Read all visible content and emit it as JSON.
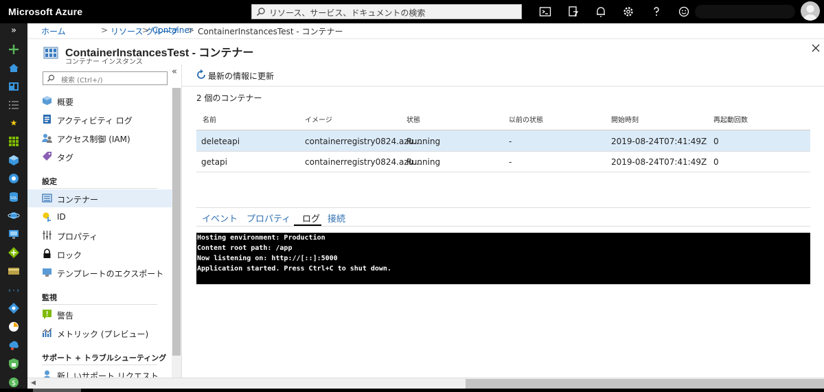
{
  "topbar": {
    "brand": "Microsoft Azure",
    "search_placeholder": "リソース、サービス、ドキュメントの検索",
    "icons": [
      "cloud-shell-icon",
      "directory-filter-icon",
      "notifications-icon",
      "settings-icon",
      "help-icon",
      "feedback-icon"
    ]
  },
  "leftnav": {
    "icons": [
      "expand-icon",
      "create-resource-icon",
      "home-icon",
      "dashboard-icon",
      "all-services-icon",
      "favorites-star-icon",
      "all-resources-icon",
      "resource-groups-icon",
      "app-services-icon",
      "sql-databases-icon",
      "cosmos-db-icon",
      "virtual-machines-icon",
      "load-balancers-icon",
      "storage-accounts-icon",
      "virtual-networks-icon",
      "azure-ad-icon",
      "monitor-icon",
      "advisor-icon",
      "security-center-icon",
      "cost-management-icon"
    ]
  },
  "breadcrumb": {
    "items": [
      "ホーム",
      "リソース グループ",
      "Container",
      "ContainerInstancesTest - コンテナー"
    ],
    "separator": ">"
  },
  "blade": {
    "title": "ContainerInstancesTest - コンテナー",
    "subtitle": "コンテナー インスタンス"
  },
  "menu": {
    "search_placeholder": "検索 (Ctrl+/)",
    "collapse_glyph": "«",
    "items_top": [
      {
        "label": "概要",
        "icon": "overview-icon"
      },
      {
        "label": "アクティビティ ログ",
        "icon": "activity-log-icon"
      },
      {
        "label": "アクセス制御 (IAM)",
        "icon": "access-control-icon"
      },
      {
        "label": "タグ",
        "icon": "tag-icon"
      }
    ],
    "section_settings": "設定",
    "items_settings": [
      {
        "label": "コンテナー",
        "icon": "containers-icon",
        "active": true
      },
      {
        "label": "ID",
        "icon": "identity-icon"
      },
      {
        "label": "プロパティ",
        "icon": "properties-icon"
      },
      {
        "label": "ロック",
        "icon": "lock-icon"
      },
      {
        "label": "テンプレートのエクスポート",
        "icon": "export-template-icon"
      }
    ],
    "section_monitoring": "監視",
    "items_monitoring": [
      {
        "label": "警告",
        "icon": "alerts-icon"
      },
      {
        "label": "メトリック (プレビュー)",
        "icon": "metrics-icon"
      }
    ],
    "section_support": "サポート + トラブルシューティング",
    "items_support": [
      {
        "label": "新しいサポート リクエスト",
        "icon": "support-request-icon"
      }
    ]
  },
  "toolbar": {
    "refresh_label": "最新の情報に更新"
  },
  "containers": {
    "count_label": "2 個のコンテナー",
    "columns": [
      "名前",
      "イメージ",
      "状態",
      "以前の状態",
      "開始時刻",
      "再起動回数"
    ],
    "rows": [
      {
        "name": "deleteapi",
        "image": "containerregistry0824.azu...",
        "state": "Running",
        "previous_state": "-",
        "start_time": "2019-08-24T07:41:49Z",
        "restart_count": "0",
        "selected": true
      },
      {
        "name": "getapi",
        "image": "containerregistry0824.azu...",
        "state": "Running",
        "previous_state": "-",
        "start_time": "2019-08-24T07:41:49Z",
        "restart_count": "0",
        "selected": false
      }
    ]
  },
  "detail_tabs": {
    "tabs": [
      "イベント",
      "プロパティ",
      "ログ",
      "接続"
    ],
    "active": "ログ"
  },
  "logs": {
    "lines": [
      "Hosting environment: Production",
      "Content root path: /app",
      "Now listening on: http://[::]:5000",
      "Application started. Press Ctrl+C to shut down."
    ]
  }
}
